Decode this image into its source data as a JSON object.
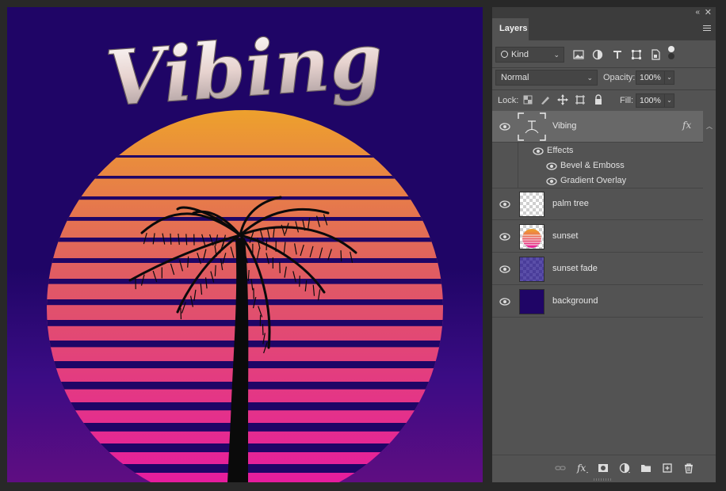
{
  "canvas": {
    "title_text": "Vibing",
    "colors": {
      "background_top": "#1f0566",
      "background_bottom": "#5f0d82",
      "sun_top": "#eea42a",
      "sun_middle": "#e05c62",
      "sun_bottom": "#e61c9e",
      "stripe": "#1f0566",
      "palm": "#0a0a0a"
    }
  },
  "panel": {
    "tab_label": "Layers",
    "filter": {
      "label": "Kind",
      "icon": "search-icon"
    },
    "blend_mode": "Normal",
    "opacity_label": "Opacity:",
    "opacity_value": "100%",
    "lock_label": "Lock:",
    "fill_label": "Fill:",
    "fill_value": "100%",
    "layers": [
      {
        "name": "Vibing",
        "type": "text",
        "selected": true,
        "has_fx": true,
        "fx_label": "fx",
        "effects_label": "Effects",
        "effects": [
          "Bevel & Emboss",
          "Gradient Overlay"
        ]
      },
      {
        "name": "palm tree",
        "type": "transparent"
      },
      {
        "name": "sunset",
        "type": "sunset"
      },
      {
        "name": "sunset fade",
        "type": "fade"
      },
      {
        "name": "background",
        "type": "solid",
        "color": "#1f0566"
      }
    ],
    "bottom_icons": [
      "link-icon",
      "fx-icon",
      "mask-icon",
      "adjustment-icon",
      "folder-icon",
      "new-layer-icon",
      "trash-icon"
    ]
  }
}
